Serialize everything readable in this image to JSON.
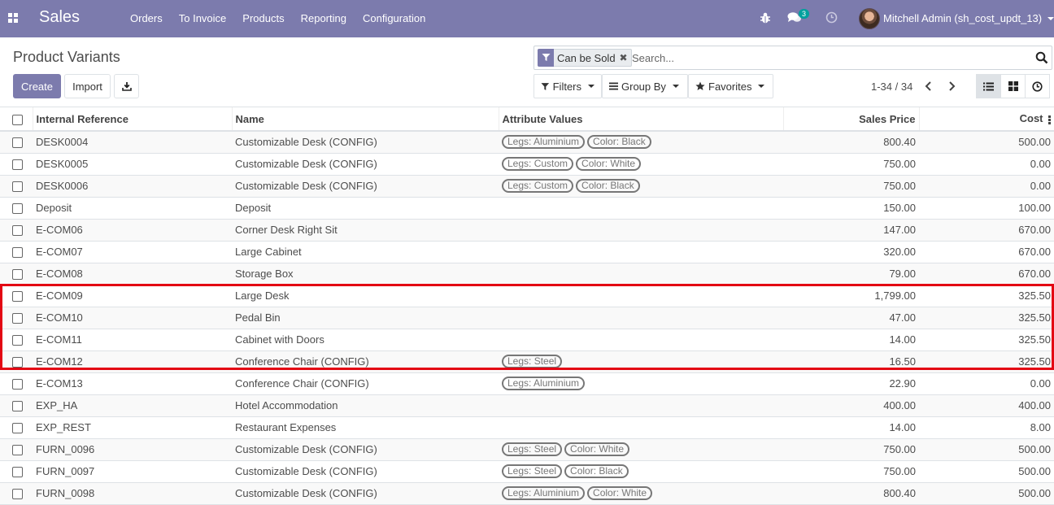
{
  "navbar": {
    "brand": "Sales",
    "menu": [
      "Orders",
      "To Invoice",
      "Products",
      "Reporting",
      "Configuration"
    ],
    "chat_count": "3",
    "user": "Mitchell Admin (sh_cost_updt_13)",
    "color": "#7c7bad"
  },
  "control": {
    "breadcrumb": "Product Variants",
    "create_label": "Create",
    "import_label": "Import",
    "facet_label": "Can be Sold",
    "search_placeholder": "Search...",
    "filters_label": "Filters",
    "groupby_label": "Group By",
    "favorites_label": "Favorites",
    "pager": "1-34 / 34"
  },
  "table": {
    "headers": {
      "ref": "Internal Reference",
      "name": "Name",
      "attrs": "Attribute Values",
      "price": "Sales Price",
      "cost": "Cost"
    },
    "rows": [
      {
        "ref": "DESK0004",
        "name": "Customizable Desk (CONFIG)",
        "tags": [
          "Legs: Aluminium",
          "Color: Black"
        ],
        "price": "800.40",
        "cost": "500.00"
      },
      {
        "ref": "DESK0005",
        "name": "Customizable Desk (CONFIG)",
        "tags": [
          "Legs: Custom",
          "Color: White"
        ],
        "price": "750.00",
        "cost": "0.00"
      },
      {
        "ref": "DESK0006",
        "name": "Customizable Desk (CONFIG)",
        "tags": [
          "Legs: Custom",
          "Color: Black"
        ],
        "price": "750.00",
        "cost": "0.00"
      },
      {
        "ref": "Deposit",
        "name": "Deposit",
        "tags": [],
        "price": "150.00",
        "cost": "100.00"
      },
      {
        "ref": "E-COM06",
        "name": "Corner Desk Right Sit",
        "tags": [],
        "price": "147.00",
        "cost": "670.00"
      },
      {
        "ref": "E-COM07",
        "name": "Large Cabinet",
        "tags": [],
        "price": "320.00",
        "cost": "670.00"
      },
      {
        "ref": "E-COM08",
        "name": "Storage Box",
        "tags": [],
        "price": "79.00",
        "cost": "670.00"
      },
      {
        "ref": "E-COM09",
        "name": "Large Desk",
        "tags": [],
        "price": "1,799.00",
        "cost": "325.50"
      },
      {
        "ref": "E-COM10",
        "name": "Pedal Bin",
        "tags": [],
        "price": "47.00",
        "cost": "325.50"
      },
      {
        "ref": "E-COM11",
        "name": "Cabinet with Doors",
        "tags": [],
        "price": "14.00",
        "cost": "325.50"
      },
      {
        "ref": "E-COM12",
        "name": "Conference Chair (CONFIG)",
        "tags": [
          "Legs: Steel"
        ],
        "price": "16.50",
        "cost": "325.50"
      },
      {
        "ref": "E-COM13",
        "name": "Conference Chair (CONFIG)",
        "tags": [
          "Legs: Aluminium"
        ],
        "price": "22.90",
        "cost": "0.00"
      },
      {
        "ref": "EXP_HA",
        "name": "Hotel Accommodation",
        "tags": [],
        "price": "400.00",
        "cost": "400.00"
      },
      {
        "ref": "EXP_REST",
        "name": "Restaurant Expenses",
        "tags": [],
        "price": "14.00",
        "cost": "8.00"
      },
      {
        "ref": "FURN_0096",
        "name": "Customizable Desk (CONFIG)",
        "tags": [
          "Legs: Steel",
          "Color: White"
        ],
        "price": "750.00",
        "cost": "500.00"
      },
      {
        "ref": "FURN_0097",
        "name": "Customizable Desk (CONFIG)",
        "tags": [
          "Legs: Steel",
          "Color: Black"
        ],
        "price": "750.00",
        "cost": "500.00"
      },
      {
        "ref": "FURN_0098",
        "name": "Customizable Desk (CONFIG)",
        "tags": [
          "Legs: Aluminium",
          "Color: White"
        ],
        "price": "800.40",
        "cost": "500.00"
      }
    ]
  }
}
